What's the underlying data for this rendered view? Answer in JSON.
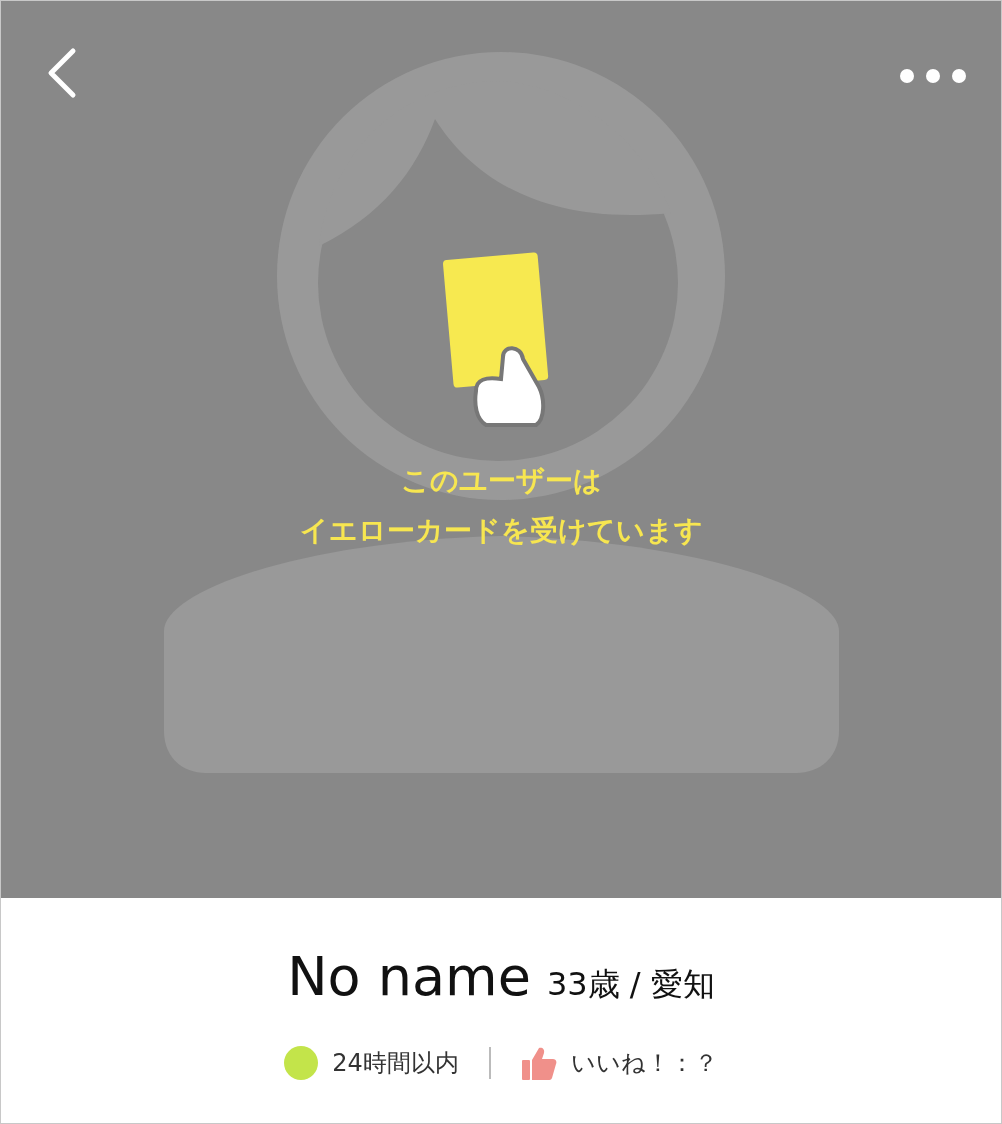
{
  "notice": {
    "lines": [
      "このユーザーは",
      "イエローカードを受けています"
    ]
  },
  "profile": {
    "name": "No name",
    "age_area": "33歳 / 愛知"
  },
  "status": {
    "login": "24時間以内",
    "likes": "いいね！：？"
  }
}
